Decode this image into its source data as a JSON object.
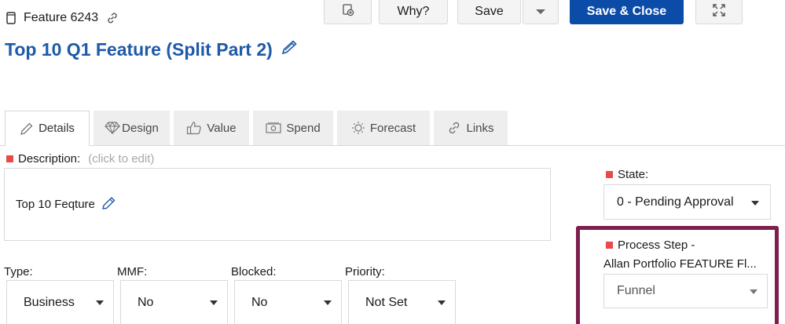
{
  "header": {
    "feature_id": "Feature 6243",
    "title": "Top 10 Q1 Feature (Split Part 2)"
  },
  "toolbar": {
    "why_label": "Why?",
    "save_label": "Save",
    "save_close_label": "Save & Close"
  },
  "tabs": [
    {
      "label": "Details",
      "icon": "pencil-icon",
      "active": true
    },
    {
      "label": "Design",
      "icon": "diamond-icon"
    },
    {
      "label": "Value",
      "icon": "thumbs-up-icon"
    },
    {
      "label": "Spend",
      "icon": "money-icon"
    },
    {
      "label": "Forecast",
      "icon": "sun-icon"
    },
    {
      "label": "Links",
      "icon": "link-icon"
    }
  ],
  "description": {
    "label": "Description:",
    "hint": "(click to edit)",
    "value": "Top 10 Feqture"
  },
  "fields": {
    "type": {
      "label": "Type:",
      "value": "Business"
    },
    "mmf": {
      "label": "MMF:",
      "value": "No"
    },
    "blocked": {
      "label": "Blocked:",
      "value": "No"
    },
    "priority": {
      "label": "Priority:",
      "value": "Not Set"
    }
  },
  "state": {
    "label": "State:",
    "value": "0 - Pending Approval"
  },
  "process_step": {
    "label_line1": "Process Step -",
    "label_line2": "Allan Portfolio FEATURE Fl...",
    "value": "Funnel"
  },
  "colors": {
    "accent": "#0b4ca8",
    "title": "#1d5aa8",
    "required": "#e84a4a",
    "highlight": "#7d1f4e"
  }
}
